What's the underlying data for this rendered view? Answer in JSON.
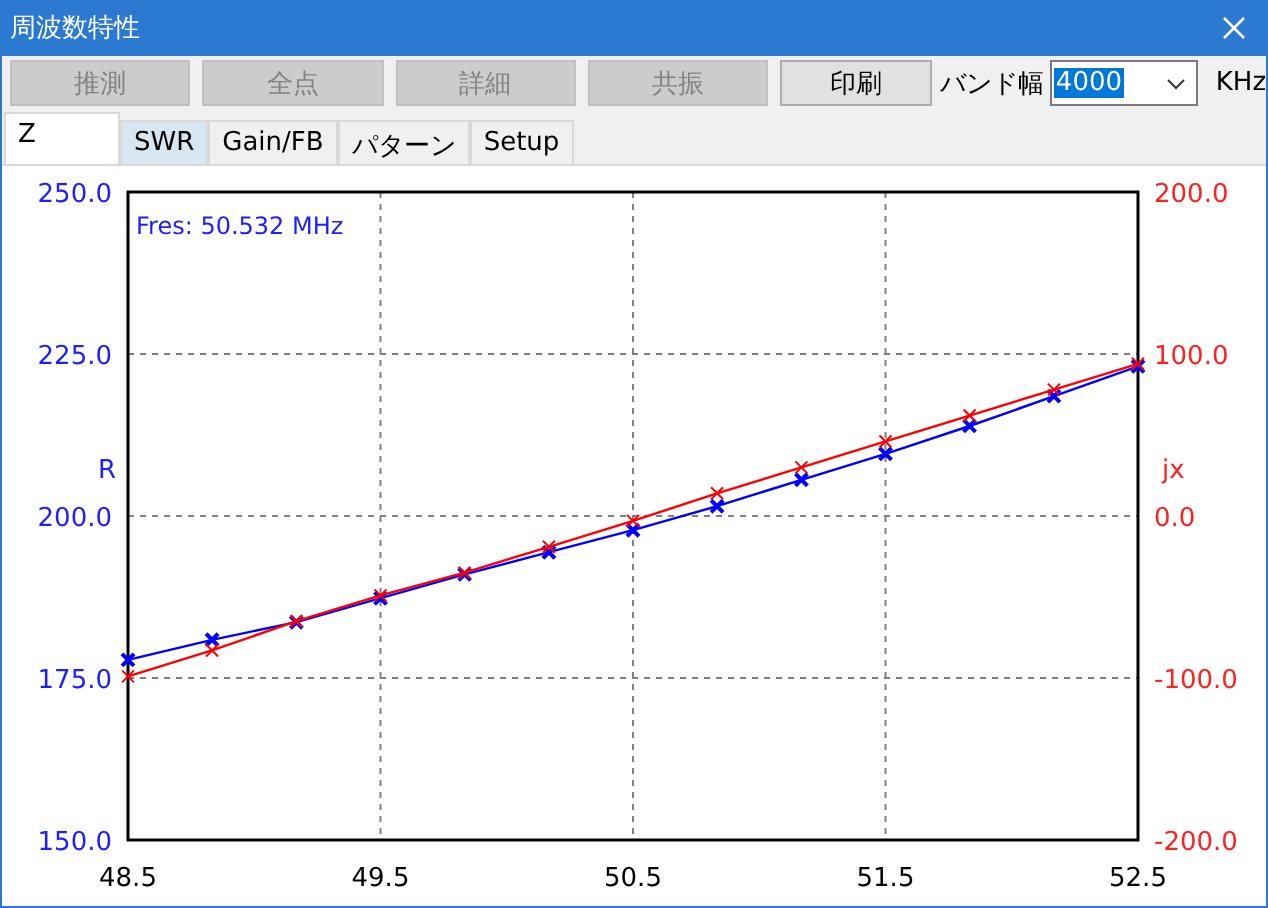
{
  "window": {
    "title": "周波数特性"
  },
  "toolbar": {
    "buttons": [
      {
        "label": "推測",
        "disabled": true
      },
      {
        "label": "全点",
        "disabled": true
      },
      {
        "label": "詳細",
        "disabled": true
      },
      {
        "label": "共振",
        "disabled": true
      },
      {
        "label": "印刷",
        "disabled": false
      }
    ],
    "bandwidth_label": "バンド幅",
    "bandwidth_value": "4000",
    "unit": "KHz"
  },
  "tabs": [
    {
      "label": "Z",
      "selected": true,
      "hovered": false
    },
    {
      "label": "SWR",
      "selected": false,
      "hovered": true
    },
    {
      "label": "Gain/FB",
      "selected": false,
      "hovered": false
    },
    {
      "label": "パターン",
      "selected": false,
      "hovered": false
    },
    {
      "label": "Setup",
      "selected": false,
      "hovered": false
    }
  ],
  "chart": {
    "annotation": "Fres: 50.532 MHz",
    "chart_data": {
      "type": "line",
      "grid": true,
      "x": [
        48.5,
        48.833,
        49.167,
        49.5,
        49.833,
        50.167,
        50.5,
        50.833,
        51.167,
        51.5,
        51.833,
        52.167,
        52.5
      ],
      "xlim": [
        48.5,
        52.5
      ],
      "xticks": [
        {
          "value": 48.5,
          "label": "48.5"
        },
        {
          "value": 49.5,
          "label": "49.5"
        },
        {
          "value": 50.5,
          "label": "50.5"
        },
        {
          "value": 51.5,
          "label": "51.5"
        },
        {
          "value": 52.5,
          "label": "52.5"
        }
      ],
      "ylim": [
        150,
        250
      ],
      "yticks": [
        {
          "value": 150,
          "label": "150.0"
        },
        {
          "value": 175,
          "label": "175.0"
        },
        {
          "value": 200,
          "label": "200.0"
        },
        {
          "value": 225,
          "label": "225.0"
        },
        {
          "value": 250,
          "label": "250.0"
        }
      ],
      "y2lim": [
        -200,
        200
      ],
      "y2ticks": [
        {
          "value": -200,
          "label": "-200.0"
        },
        {
          "value": -100,
          "label": "-100.0"
        },
        {
          "value": 0,
          "label": "0.0"
        },
        {
          "value": 100,
          "label": "100.0"
        },
        {
          "value": 200,
          "label": "200.0"
        }
      ],
      "series": [
        {
          "name": "R",
          "color": "#0000ff",
          "marker": "x",
          "values": [
            177.8,
            180.9,
            183.6,
            187.3,
            191.0,
            194.4,
            197.8,
            201.5,
            205.6,
            209.6,
            213.9,
            218.5,
            223.1
          ]
        },
        {
          "name": "jx",
          "color": "#ff0000",
          "axis": "y2",
          "marker": "x",
          "values": [
            -99,
            -83,
            -65,
            -49,
            -35,
            -19,
            -3,
            14,
            30,
            46,
            62,
            78,
            94
          ]
        }
      ]
    }
  }
}
